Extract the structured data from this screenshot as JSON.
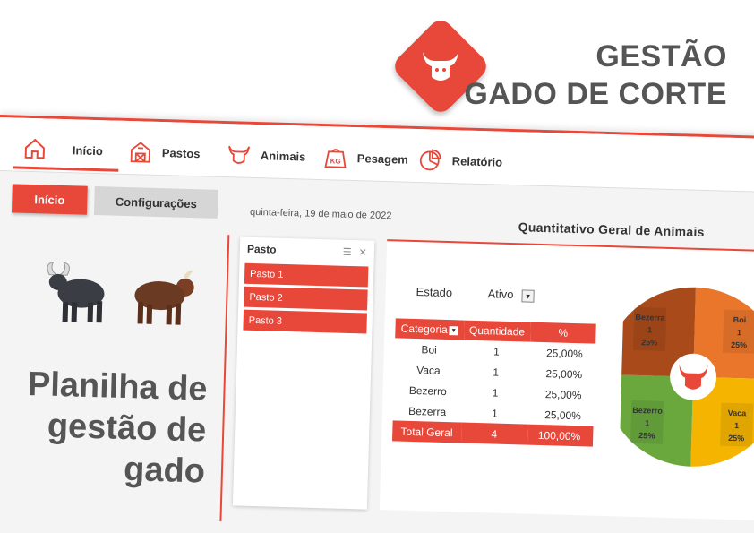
{
  "brand": {
    "title_line1": "GESTÃO",
    "title_line2": "GADO DE CORTE",
    "accent_color": "#e8483a",
    "logo_icon": "bull-head-icon"
  },
  "nav": {
    "items": [
      {
        "label": "Início",
        "icon": "home-icon",
        "active": true
      },
      {
        "label": "Pastos",
        "icon": "barn-icon"
      },
      {
        "label": "Animais",
        "icon": "bull-head-icon"
      },
      {
        "label": "Pesagem",
        "icon": "weight-kg-icon"
      },
      {
        "label": "Relatório",
        "icon": "pie-chart-icon"
      }
    ]
  },
  "subnav": {
    "inicio_label": "Início",
    "config_label": "Configurações"
  },
  "date_text": "quinta-feira, 19 de maio de 2022",
  "left": {
    "title_line1": "Planilha de",
    "title_line2": "gestão de",
    "title_line3": "gado"
  },
  "slicer": {
    "title": "Pasto",
    "items": [
      "Pasto 1",
      "Pasto 2",
      "Pasto 3"
    ]
  },
  "dashboard": {
    "title": "Quantitativo Geral de Animais",
    "filter_label": "Estado",
    "filter_value": "Ativo",
    "table": {
      "headers": [
        "Categoria",
        "Quantidade",
        "%"
      ],
      "rows": [
        [
          "Boi",
          "1",
          "25,00%"
        ],
        [
          "Vaca",
          "1",
          "25,00%"
        ],
        [
          "Bezerro",
          "1",
          "25,00%"
        ],
        [
          "Bezerra",
          "1",
          "25,00%"
        ]
      ],
      "total": [
        "Total Geral",
        "4",
        "100,00%"
      ]
    }
  },
  "chart_data": {
    "type": "pie",
    "categories": [
      "Boi",
      "Vaca",
      "Bezerro",
      "Bezerra"
    ],
    "values": [
      1,
      1,
      1,
      1
    ],
    "labels": [
      {
        "name": "Boi",
        "count": "1",
        "pct": "25%"
      },
      {
        "name": "Vaca",
        "count": "1",
        "pct": "25%"
      },
      {
        "name": "Bezerro",
        "count": "1",
        "pct": "25%"
      },
      {
        "name": "Bezerra",
        "count": "1",
        "pct": "25%"
      }
    ],
    "colors": [
      "#e9762b",
      "#f4b400",
      "#6aa83e",
      "#a94a1a"
    ]
  }
}
